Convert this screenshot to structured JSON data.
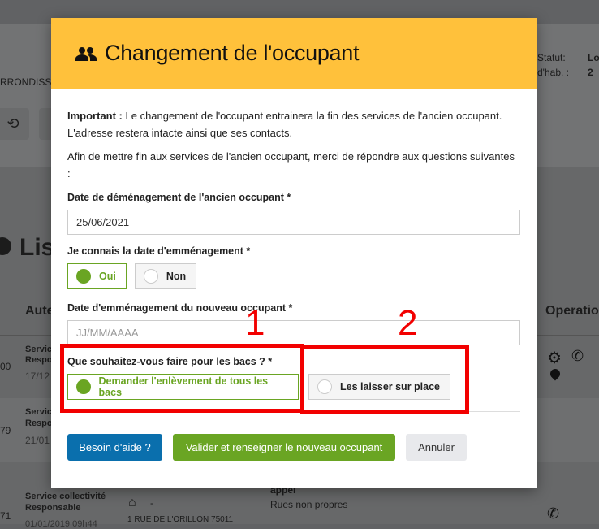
{
  "background": {
    "header_text": "RRONDISS",
    "status_label": "Statut:",
    "status_value": "Lo",
    "hab_label": "d'hab. :",
    "hab_value": "2",
    "section_title": "Lis",
    "col_author": "Aute",
    "col_operations": "Operation",
    "rows": [
      {
        "id": "00",
        "type1": "Servic",
        "type2": "Respo",
        "date": "17/12"
      },
      {
        "id": "79",
        "type1": "Servic",
        "type2": "Respo",
        "date": "21/01"
      },
      {
        "id": "71",
        "type1": "Service collectivité",
        "type2": "Responsable",
        "date": "01/01/2019 09h44",
        "address": "1 RUE DE L'ORILLON 75011",
        "dash": "-",
        "reason_title": "appel",
        "reason": "Rues non propres"
      }
    ]
  },
  "modal": {
    "title": "Changement de l'occupant",
    "important_label": "Important :",
    "important_text": " Le changement de l'occupant entrainera la fin des services de l'ancien occupant. L'adresse restera intacte ainsi que ses contacts.",
    "intro": "Afin de mettre fin aux services de l'ancien occupant, merci de répondre aux questions suivantes :",
    "move_out_label": "Date de déménagement de l'ancien occupant *",
    "move_out_value": "25/06/2021",
    "know_date_label": "Je connais la date d'emménagement *",
    "know_date_options": [
      {
        "label": "Oui",
        "selected": true
      },
      {
        "label": "Non",
        "selected": false
      }
    ],
    "move_in_label": "Date d'emménagement du nouveau occupant *",
    "move_in_placeholder": "JJ/MM/AAAA",
    "bins_label": "Que souhaitez-vous faire pour les bacs ? *",
    "bins_options": [
      {
        "label": "Demander l'enlèvement de tous les bacs",
        "selected": true
      },
      {
        "label": "Les laisser sur place",
        "selected": false
      }
    ],
    "help_button": "Besoin d'aide ?",
    "validate_button": "Valider et renseigner le nouveau occupant",
    "cancel_button": "Annuler"
  },
  "annotations": [
    "1",
    "2"
  ],
  "colors": {
    "header": "#ffc13b",
    "green": "#6aa523",
    "blue": "#0a6fad",
    "annotation": "#f20000"
  }
}
